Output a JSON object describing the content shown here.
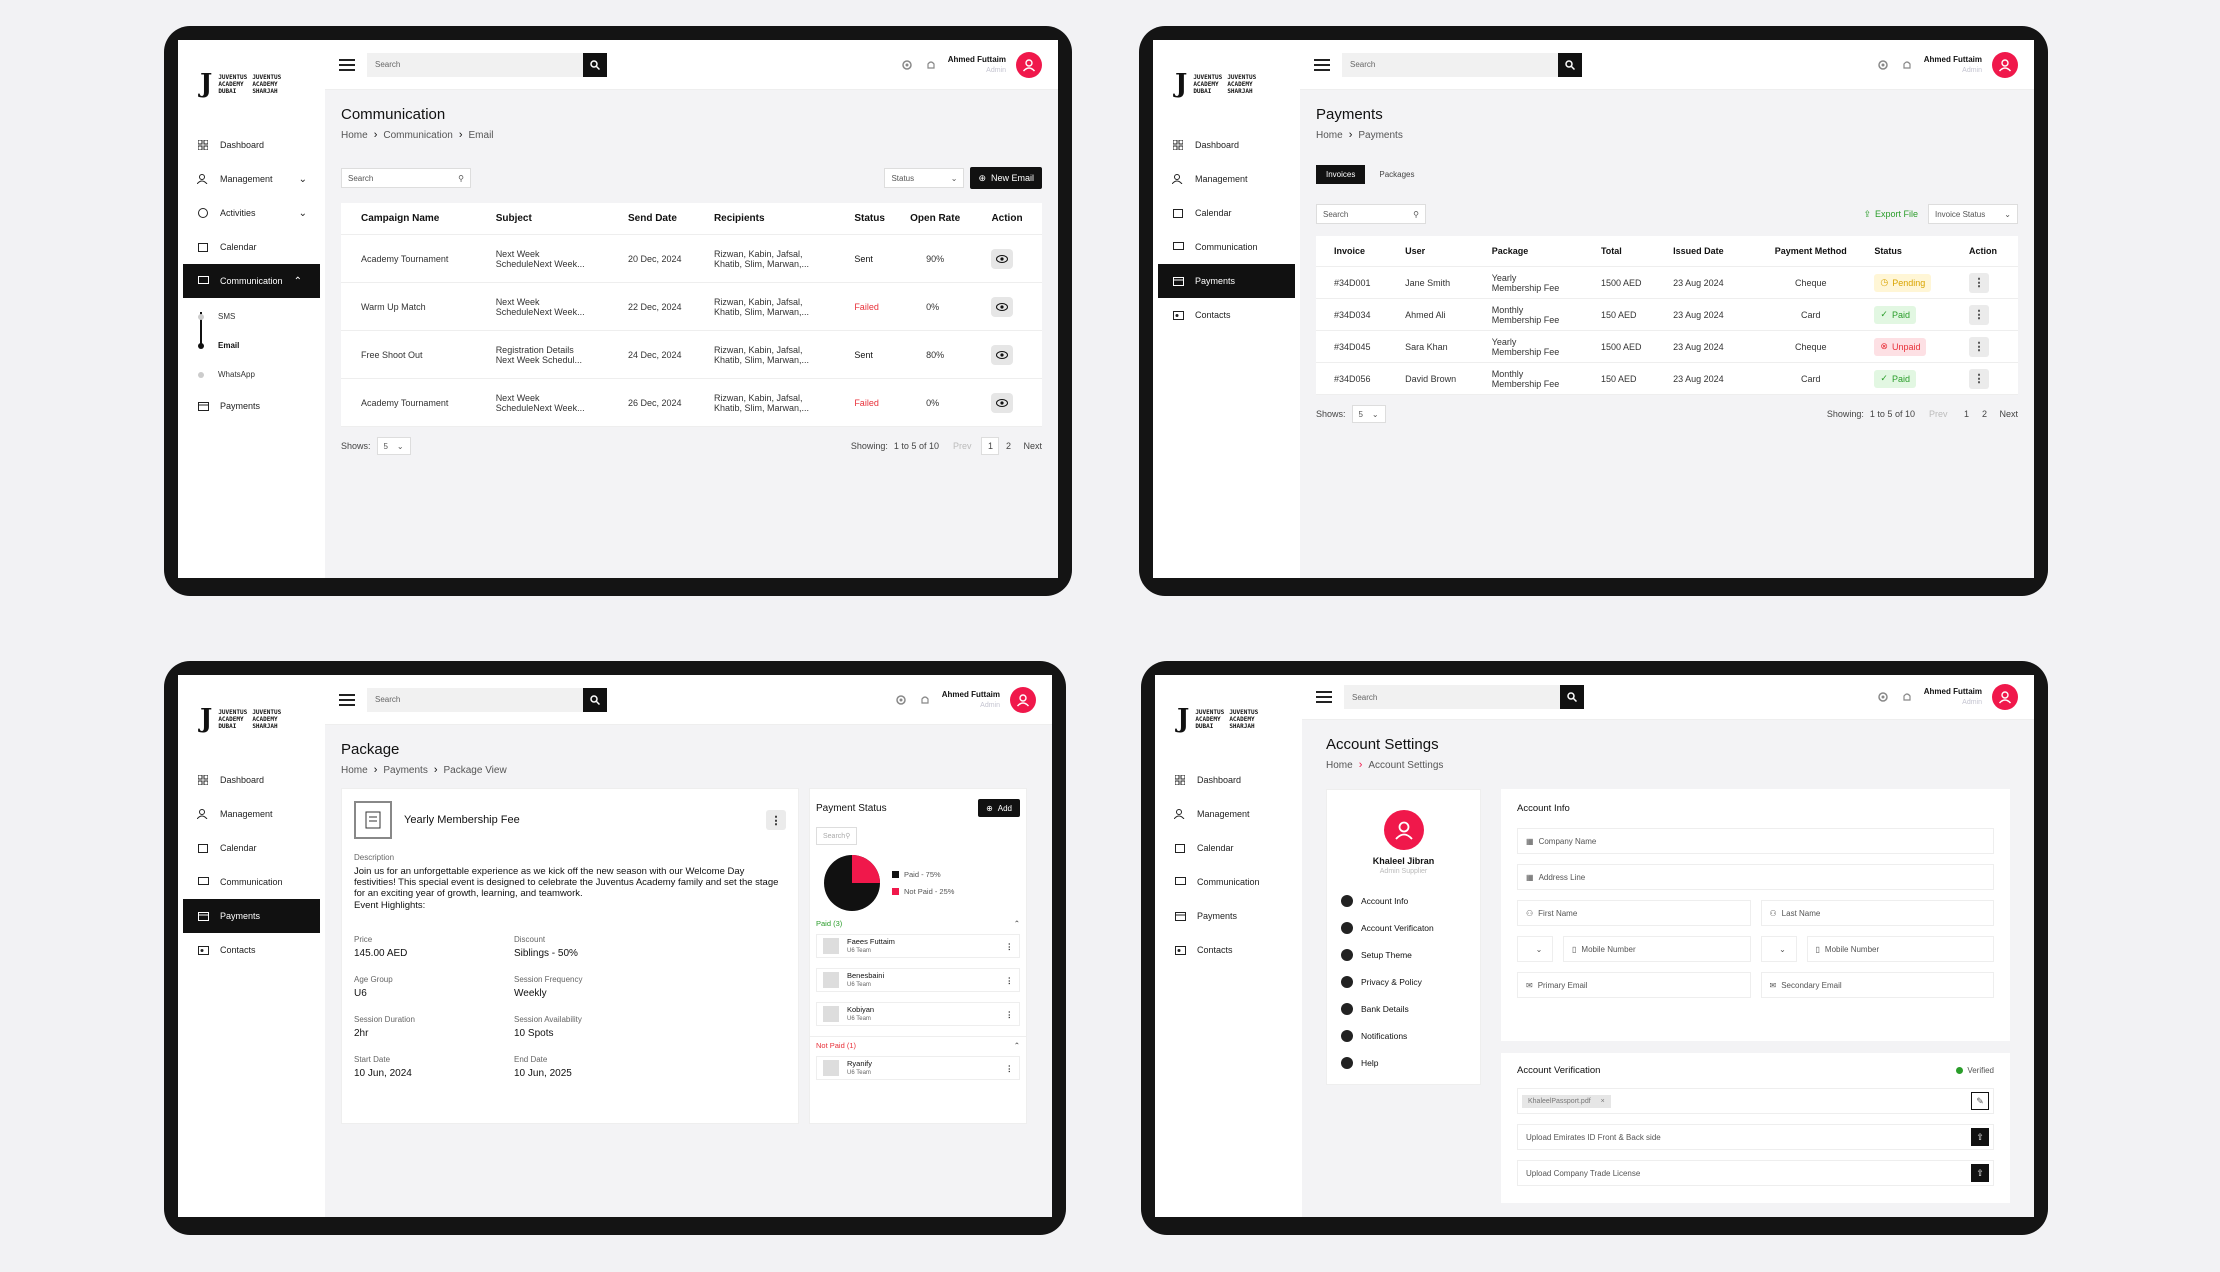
{
  "brand": {
    "mark": "J",
    "academy_dubai": [
      "JUVENTUS",
      "ACADEMY",
      "DUBAI"
    ],
    "academy_sharjah": [
      "JUVENTUS",
      "ACADEMY",
      "SHARJAH"
    ]
  },
  "topbar": {
    "search_placeholder": "Search",
    "user_name": "Ahmed Futtaim",
    "user_role": "Admin"
  },
  "screen1": {
    "nav": [
      "Dashboard",
      "Management",
      "Activities",
      "Calendar",
      "Communication"
    ],
    "subnav": [
      "SMS",
      "Email",
      "WhatsApp"
    ],
    "nav_after": "Payments",
    "title": "Communication",
    "crumbs": [
      "Home",
      "Communication",
      "Email"
    ],
    "filter_search": "Search",
    "status_select": "Status",
    "new_email": "New Email",
    "columns": [
      "Campaign Name",
      "Subject",
      "Send Date",
      "Recipients",
      "Status",
      "Open Rate",
      "Action"
    ],
    "rows": [
      {
        "name": "Academy Tournament",
        "subject": [
          "Next Week",
          "ScheduleNext Week..."
        ],
        "date": "20 Dec, 2024",
        "recipients": [
          "Rizwan, Kabin, Jafsal,",
          "Khatib, Slim, Marwan,..."
        ],
        "status": "Sent",
        "rate": "90%"
      },
      {
        "name": "Warm Up Match",
        "subject": [
          "Next Week",
          "ScheduleNext Week..."
        ],
        "date": "22 Dec, 2024",
        "recipients": [
          "Rizwan, Kabin, Jafsal,",
          "Khatib, Slim, Marwan,..."
        ],
        "status": "Failed",
        "rate": "0%"
      },
      {
        "name": "Free Shoot Out",
        "subject": [
          "Registration Details",
          "Next Week Schedul..."
        ],
        "date": "24 Dec, 2024",
        "recipients": [
          "Rizwan, Kabin, Jafsal,",
          "Khatib, Slim, Marwan,..."
        ],
        "status": "Sent",
        "rate": "80%"
      },
      {
        "name": "Academy Tournament",
        "subject": [
          "Next Week",
          "ScheduleNext Week..."
        ],
        "date": "26 Dec, 2024",
        "recipients": [
          "Rizwan, Kabin, Jafsal,",
          "Khatib, Slim, Marwan,..."
        ],
        "status": "Failed",
        "rate": "0%"
      }
    ],
    "shows_label": "Shows:",
    "shows_value": "5",
    "showing_label": "Showing:",
    "showing_value": "1 to 5 of 10",
    "prev": "Prev",
    "pages": [
      "1",
      "2"
    ],
    "next": "Next"
  },
  "screen2": {
    "nav": [
      "Dashboard",
      "Management",
      "Calendar",
      "Communication",
      "Payments",
      "Contacts"
    ],
    "title": "Payments",
    "crumbs": [
      "Home",
      "Payments"
    ],
    "tabs": [
      "Invoices",
      "Packages"
    ],
    "filter_search": "Search",
    "export": "Export File",
    "invoice_status": "Invoice Status",
    "columns": [
      "Invoice",
      "User",
      "Package",
      "Total",
      "Issued Date",
      "Payment Method",
      "Status",
      "Action"
    ],
    "rows": [
      {
        "inv": "#34D001",
        "user": "Jane Smith",
        "pkg": [
          "Yearly",
          "Membership Fee"
        ],
        "total": "1500 AED",
        "date": "23 Aug 2024",
        "method": "Cheque",
        "status": "Pending"
      },
      {
        "inv": "#34D034",
        "user": "Ahmed Ali",
        "pkg": [
          "Monthly",
          "Membership Fee"
        ],
        "total": "150 AED",
        "date": "23 Aug 2024",
        "method": "Card",
        "status": "Paid"
      },
      {
        "inv": "#34D045",
        "user": "Sara Khan",
        "pkg": [
          "Yearly",
          "Membership Fee"
        ],
        "total": "1500 AED",
        "date": "23 Aug 2024",
        "method": "Cheque",
        "status": "Unpaid"
      },
      {
        "inv": "#34D056",
        "user": "David Brown",
        "pkg": [
          "Monthly",
          "Membership Fee"
        ],
        "total": "150 AED",
        "date": "23 Aug 2024",
        "method": "Card",
        "status": "Paid"
      }
    ],
    "shows_label": "Shows:",
    "shows_value": "5",
    "showing_label": "Showing:",
    "showing_value": "1 to 5 of 10",
    "prev": "Prev",
    "pages": [
      "1",
      "2"
    ],
    "next": "Next"
  },
  "screen3": {
    "nav": [
      "Dashboard",
      "Management",
      "Calendar",
      "Communication",
      "Payments",
      "Contacts"
    ],
    "title": "Package",
    "crumbs": [
      "Home",
      "Payments",
      "Package View"
    ],
    "pkg_name": "Yearly Membership Fee",
    "desc_label": "Description",
    "desc": "Join us for an unforgettable experience as we kick off the new season with our Welcome Day festivities! This special event is designed to celebrate the Juventus Academy family and set the stage for an exciting year of growth, learning, and teamwork.",
    "highlights": "Event Highlights:",
    "fields": [
      {
        "label": "Price",
        "value": "145.00 AED"
      },
      {
        "label": "Discount",
        "value": "Siblings - 50%"
      },
      {
        "label": "Age Group",
        "value": "U6"
      },
      {
        "label": "Session Frequency",
        "value": "Weekly"
      },
      {
        "label": "Session Duration",
        "value": "2hr"
      },
      {
        "label": "Session Availability",
        "value": "10 Spots"
      },
      {
        "label": "Start Date",
        "value": "10 Jun, 2024"
      },
      {
        "label": "End Date",
        "value": "10 Jun, 2025"
      }
    ],
    "ps_title": "Payment Status",
    "add": "Add",
    "ps_search": "Search",
    "legend_paid": "Paid - 75%",
    "legend_unpaid": "Not Paid - 25%",
    "paid_pct": 75,
    "paid_group": "Paid (3)",
    "paid_people": [
      {
        "name": "Faees Futtaim",
        "team": "U6 Team"
      },
      {
        "name": "Benesbaini",
        "team": "U6 Team"
      },
      {
        "name": "Kobiyan",
        "team": "U6 Team"
      }
    ],
    "unpaid_group": "Not Paid (1)",
    "unpaid_people": [
      {
        "name": "Ryanify",
        "team": "U6 Team"
      }
    ]
  },
  "screen4": {
    "nav": [
      "Dashboard",
      "Management",
      "Calendar",
      "Communication",
      "Payments",
      "Contacts"
    ],
    "title": "Account Settings",
    "crumbs": [
      "Home",
      "Account Settings"
    ],
    "profile_name": "Khaleel Jibran",
    "profile_role": "Admin Supplier",
    "menu": [
      "Account Info",
      "Account Verificaton",
      "Setup Theme",
      "Privacy & Policy",
      "Bank Details",
      "Notifications",
      "Help"
    ],
    "info_title": "Account  Info",
    "company": "Company Name",
    "address": "Address Line",
    "first": "First Name",
    "last": "Last Name",
    "mobile": "Mobile Number",
    "mobile2": "Mobile Number",
    "primary_email": "Primary Email",
    "secondary_email": "Secondary Email",
    "verif_title": "Account Verification",
    "verified": "Verified",
    "file_chip": "KhaleelPassport.pdf",
    "upload1": "Upload Emirates ID Front & Back side",
    "upload2": "Upload Company Trade License"
  },
  "colors": {
    "accent": "#f0184b",
    "dark": "#111111",
    "failed": "#e8313a"
  }
}
